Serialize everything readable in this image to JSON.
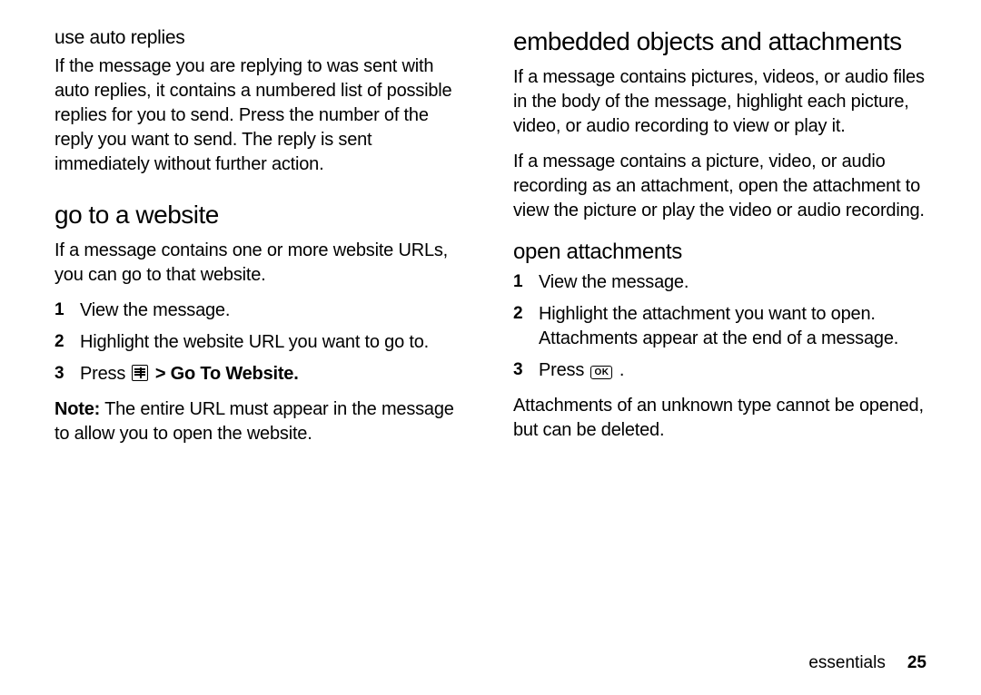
{
  "left": {
    "subhead1": "use auto replies",
    "p1": "If the message you are replying to was sent with auto replies, it contains a numbered list of possible replies for you to send. Press the number of the reply you want to send. The reply is sent immediately without further action.",
    "h2": "go to a website",
    "p2": "If a message contains one or more website URLs, you can go to that website.",
    "steps": {
      "s1": "View the message.",
      "s2": "Highlight the website URL you want to go to.",
      "s3_pre": "Press ",
      "s3_post": " > Go To Website."
    },
    "note_label": "Note:",
    "note_body": " The entire URL must appear in the message to allow you to open the website."
  },
  "right": {
    "h2a": "embedded objects and attachments",
    "p1": "If a message contains pictures, videos, or audio files in the body of the message, highlight each picture, video, or audio recording to view or play it.",
    "p2": "If a message contains a picture, video, or audio recording as an attachment, open the attachment to view the picture or play the video or audio recording.",
    "h3": "open attachments",
    "steps": {
      "s1": "View the message.",
      "s2": "Highlight the attachment you want to open. Attachments appear at the end of a message.",
      "s3_pre": "Press ",
      "s3_post": " ."
    },
    "p3": "Attachments of an unknown type cannot be opened, but can be deleted."
  },
  "footer": {
    "section": "essentials",
    "page": "25"
  }
}
